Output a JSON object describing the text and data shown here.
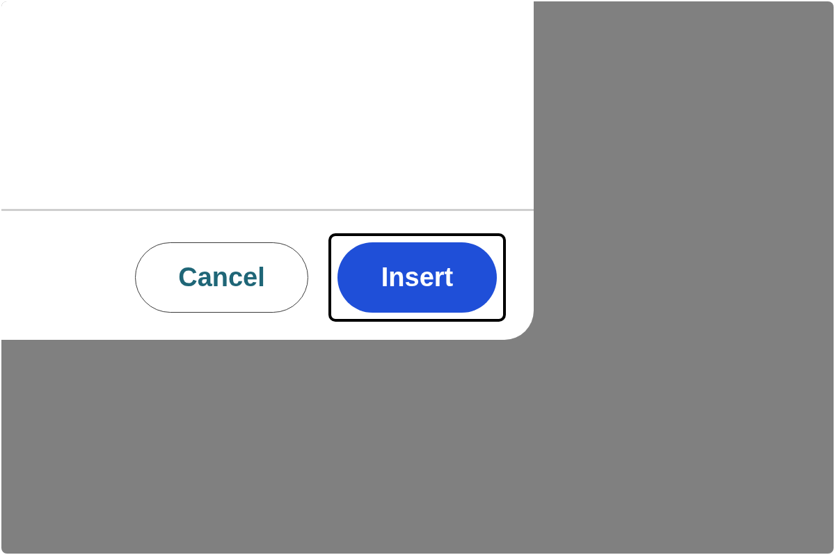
{
  "dialog": {
    "buttons": [
      {
        "label": "Cancel",
        "kind": "secondary",
        "focused": false
      },
      {
        "label": "Insert",
        "kind": "primary",
        "focused": true
      }
    ]
  }
}
